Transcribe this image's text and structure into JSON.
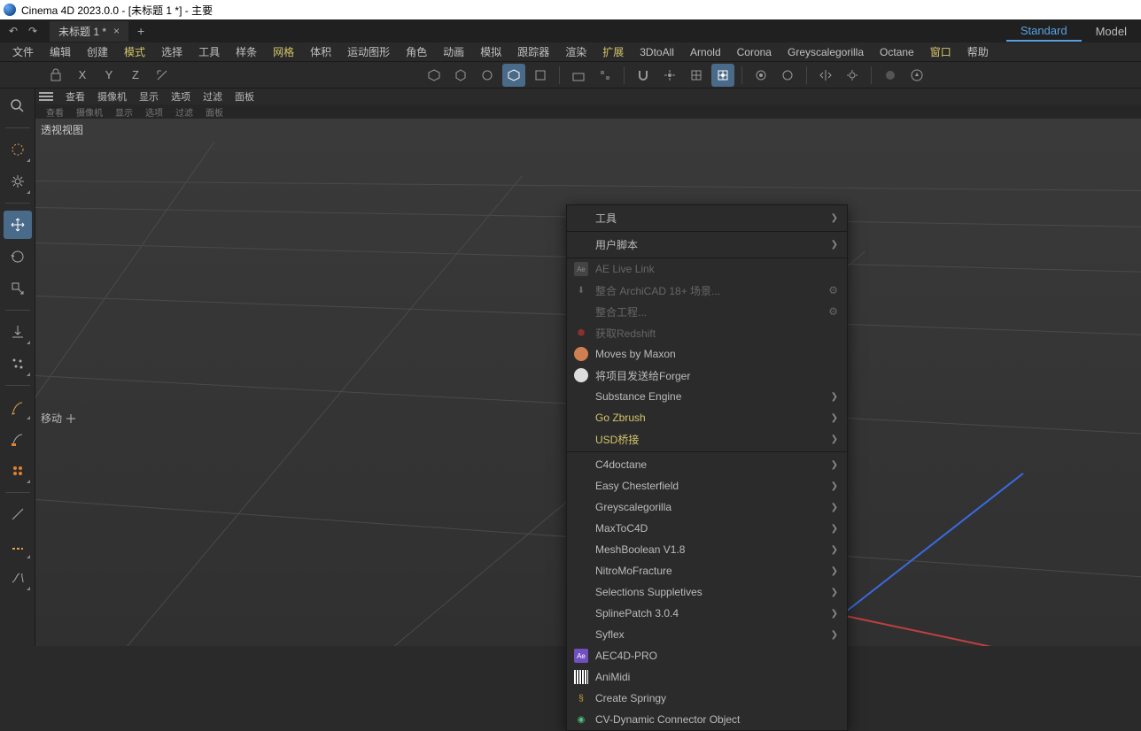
{
  "window": {
    "title": "Cinema 4D 2023.0.0 - [未标题 1 *] - 主要"
  },
  "tab": {
    "label": "未标题 1 *",
    "close": "×",
    "plus": "+"
  },
  "history": {
    "undo": "↶",
    "redo": "↷"
  },
  "layouts": {
    "standard": "Standard",
    "model": "Model"
  },
  "menu": {
    "file": "文件",
    "edit": "编辑",
    "create": "创建",
    "mode": "模式",
    "select": "选择",
    "tools": "工具",
    "spline": "样条",
    "mesh": "网格",
    "volume": "体积",
    "mograph": "运动图形",
    "character": "角色",
    "animate": "动画",
    "simulate": "模拟",
    "tracker": "跟踪器",
    "render": "渲染",
    "extensions": "扩展",
    "dtoall": "3DtoAll",
    "arnold": "Arnold",
    "corona": "Corona",
    "gsg": "Greyscalegorilla",
    "octane": "Octane",
    "window": "窗口",
    "help": "帮助"
  },
  "xyz": {
    "x": "X",
    "y": "Y",
    "z": "Z"
  },
  "viewport": {
    "menus": {
      "view": "查看",
      "camera": "摄像机",
      "display": "显示",
      "options": "选项",
      "filter": "过滤",
      "panel": "面板"
    },
    "menus2": {
      "view": "查看",
      "camera": "摄像机",
      "display": "显示",
      "options": "选项",
      "filter": "过滤",
      "panel": "面板"
    },
    "label": "透视视图",
    "tool": "移动"
  },
  "ext_menu": {
    "tools": "工具",
    "userscripts": "用户脚本",
    "ae_live": "AE Live Link",
    "archicad": "整合 ArchiCAD 18+ 场景...",
    "merge_project": "整合工程...",
    "redshift": "获取Redshift",
    "moves": "Moves by Maxon",
    "forger": "将项目发送给Forger",
    "substance": "Substance Engine",
    "gozbrush": "Go Zbrush",
    "usd": "USD桥接",
    "c4doctane": "C4doctane",
    "chesterfield": "Easy Chesterfield",
    "gsg": "Greyscalegorilla",
    "maxtoc4d": "MaxToC4D",
    "meshbool": "MeshBoolean V1.8",
    "nitro": "NitroMoFracture",
    "selsup": "Selections Suppletives",
    "splinepatch": "SplinePatch 3.0.4",
    "syflex": "Syflex",
    "aec4d": "AEC4D-PRO",
    "animidi": "AniMidi",
    "springy": "Create Springy",
    "cvdyn": "CV-Dynamic Connector Object"
  }
}
